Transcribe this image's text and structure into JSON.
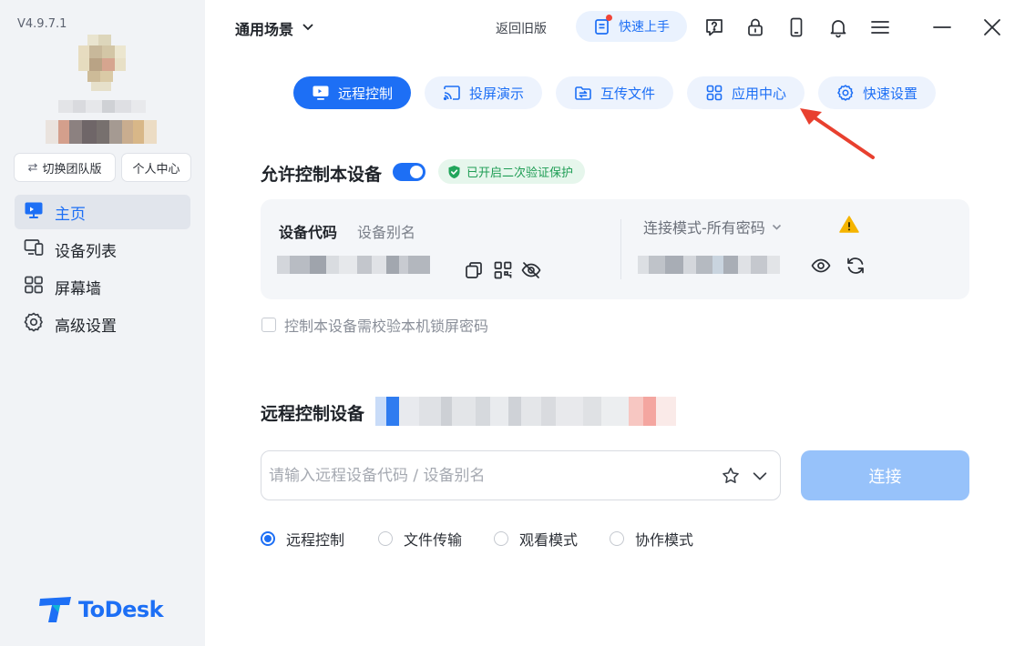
{
  "sidebar": {
    "version": "V4.9.7.1",
    "switch_team_label": "切换团队版",
    "personal_center_label": "个人中心",
    "nav": [
      {
        "label": "主页",
        "icon": "monitor-icon",
        "active": true
      },
      {
        "label": "设备列表",
        "icon": "device-list-icon",
        "active": false
      },
      {
        "label": "屏幕墙",
        "icon": "grid-icon",
        "active": false
      },
      {
        "label": "高级设置",
        "icon": "gear-icon",
        "active": false
      }
    ],
    "logo_text": "ToDesk"
  },
  "topbar": {
    "scene_label": "通用场景",
    "back_old_label": "返回旧版",
    "quick_start_label": "快速上手",
    "icons": [
      "help-icon",
      "lock-icon",
      "phone-icon",
      "bell-icon",
      "menu-icon",
      "minimize-icon",
      "close-icon"
    ]
  },
  "tabs": [
    {
      "label": "远程控制",
      "icon": "monitor-icon",
      "active": true
    },
    {
      "label": "投屏演示",
      "icon": "cast-icon",
      "active": false
    },
    {
      "label": "互传文件",
      "icon": "transfer-icon",
      "active": false
    },
    {
      "label": "应用中心",
      "icon": "apps-icon",
      "active": false
    },
    {
      "label": "快速设置",
      "icon": "gear-icon",
      "active": false
    }
  ],
  "allow_control": {
    "title": "允许控制本设备",
    "toggle_on": true,
    "verify_badge": "已开启二次验证保护",
    "device_code_label": "设备代码",
    "device_alias_label": "设备别名",
    "connect_mode_label": "连接模式-所有密码",
    "lock_password_label": "控制本设备需校验本机锁屏密码"
  },
  "remote_control": {
    "title": "远程控制设备",
    "input_placeholder": "请输入远程设备代码 / 设备别名",
    "input_value": "",
    "connect_label": "连接",
    "modes": [
      {
        "label": "远程控制",
        "checked": true
      },
      {
        "label": "文件传输",
        "checked": false
      },
      {
        "label": "观看模式",
        "checked": false
      },
      {
        "label": "协作模式",
        "checked": false
      }
    ]
  },
  "colors": {
    "accent": "#1d6ff5",
    "sidebar_bg": "#f1f3f6",
    "success": "#1f9d55",
    "warning": "#f5b400",
    "annotation_arrow": "#e8402f"
  }
}
